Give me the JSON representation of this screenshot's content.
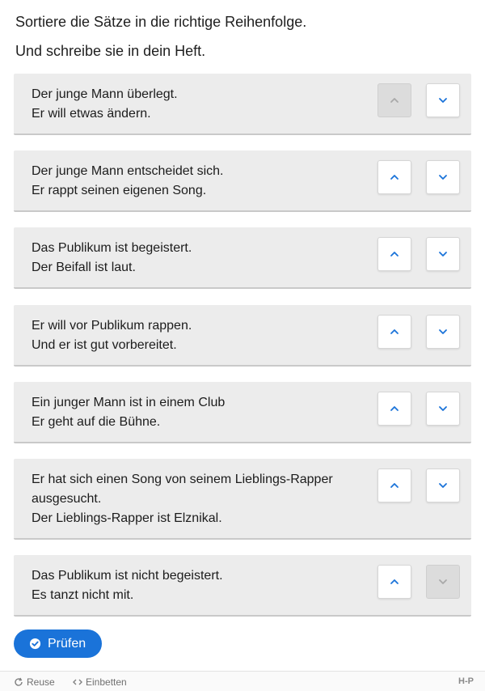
{
  "instructions": {
    "line1": "Sortiere die Sätze in die richtige Reihenfolge.",
    "line2": "Und schreibe sie in dein Heft."
  },
  "items": [
    {
      "lines": [
        "Der junge Mann überlegt.",
        "Er will etwas ändern."
      ],
      "up_disabled": true,
      "down_disabled": false
    },
    {
      "lines": [
        "Der junge Mann entscheidet sich.",
        "Er rappt seinen eigenen Song."
      ],
      "up_disabled": false,
      "down_disabled": false
    },
    {
      "lines": [
        "Das Publikum ist begeistert.",
        "Der Beifall ist laut."
      ],
      "up_disabled": false,
      "down_disabled": false
    },
    {
      "lines": [
        "Er will vor Publikum rappen.",
        "Und er ist gut vorbereitet."
      ],
      "up_disabled": false,
      "down_disabled": false
    },
    {
      "lines": [
        "Ein junger Mann ist in einem Club",
        "Er geht auf die Bühne."
      ],
      "up_disabled": false,
      "down_disabled": false
    },
    {
      "lines": [
        "Er hat sich einen Song von seinem Lieblings-Rapper ausgesucht.",
        "Der Lieblings-Rapper ist Elznikal."
      ],
      "up_disabled": false,
      "down_disabled": false
    },
    {
      "lines": [
        "Das Publikum ist nicht begeistert.",
        "Es tanzt nicht mit."
      ],
      "up_disabled": false,
      "down_disabled": true
    }
  ],
  "check_button": {
    "label": "Prüfen"
  },
  "footer": {
    "reuse_label": "Reuse",
    "embed_label": "Einbetten",
    "brand": "H-P"
  },
  "colors": {
    "accent": "#1a73d9",
    "item_bg": "#ececec",
    "disabled_btn": "#dcdcdc"
  }
}
